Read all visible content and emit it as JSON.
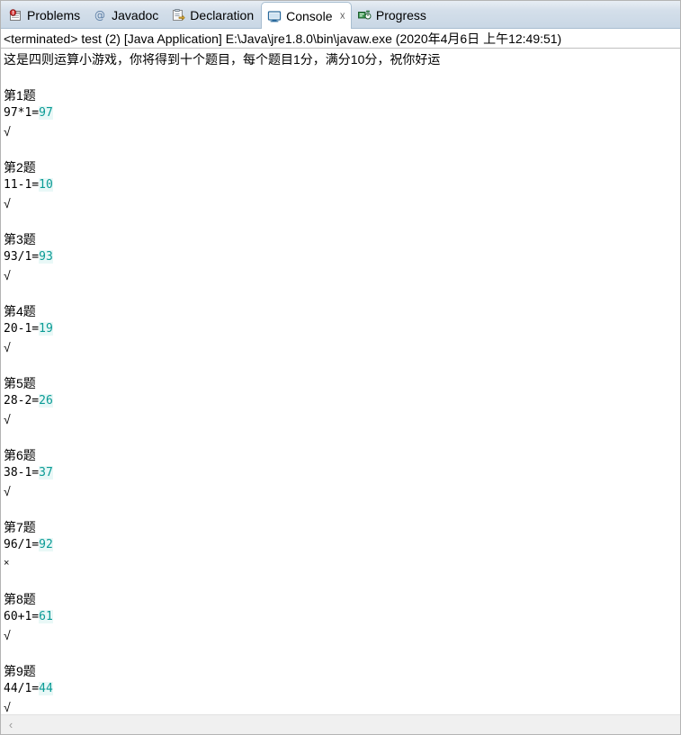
{
  "tabs": [
    {
      "id": "problems",
      "label": "Problems",
      "icon": "problems-icon",
      "active": false,
      "closable": false
    },
    {
      "id": "javadoc",
      "label": "Javadoc",
      "icon": "javadoc-icon",
      "active": false,
      "closable": false
    },
    {
      "id": "declaration",
      "label": "Declaration",
      "icon": "declaration-icon",
      "active": false,
      "closable": false
    },
    {
      "id": "console",
      "label": "Console",
      "icon": "console-icon",
      "active": true,
      "closable": true,
      "close_glyph": "☓"
    },
    {
      "id": "progress",
      "label": "Progress",
      "icon": "progress-icon",
      "active": false,
      "closable": false
    }
  ],
  "console": {
    "launch_line": "<terminated> test (2) [Java Application] E:\\Java\\jre1.8.0\\bin\\javaw.exe (2020年4月6日 上午12:49:51)",
    "intro": "这是四则运算小游戏，你将得到十个题目，每个题目1分，满分10分，祝你好运",
    "correct_glyph": "√",
    "wrong_glyph": "×",
    "answer_color": "#0a9b95",
    "questions": [
      {
        "title": "第1题",
        "expr": "97*1=",
        "answer": "97",
        "mark": "√",
        "correct": true
      },
      {
        "title": "第2题",
        "expr": "11-1=",
        "answer": "10",
        "mark": "√",
        "correct": true
      },
      {
        "title": "第3题",
        "expr": "93/1=",
        "answer": "93",
        "mark": "√",
        "correct": true
      },
      {
        "title": "第4题",
        "expr": "20-1=",
        "answer": "19",
        "mark": "√",
        "correct": true
      },
      {
        "title": "第5题",
        "expr": "28-2=",
        "answer": "26",
        "mark": "√",
        "correct": true
      },
      {
        "title": "第6题",
        "expr": "38-1=",
        "answer": "37",
        "mark": "√",
        "correct": true
      },
      {
        "title": "第7题",
        "expr": "96/1=",
        "answer": "92",
        "mark": "×",
        "correct": false
      },
      {
        "title": "第8题",
        "expr": "60+1=",
        "answer": "61",
        "mark": "√",
        "correct": true
      },
      {
        "title": "第9题",
        "expr": "44/1=",
        "answer": "44",
        "mark": "√",
        "correct": true
      }
    ]
  },
  "scrollbar": {
    "left_arrow_glyph": "‹"
  }
}
